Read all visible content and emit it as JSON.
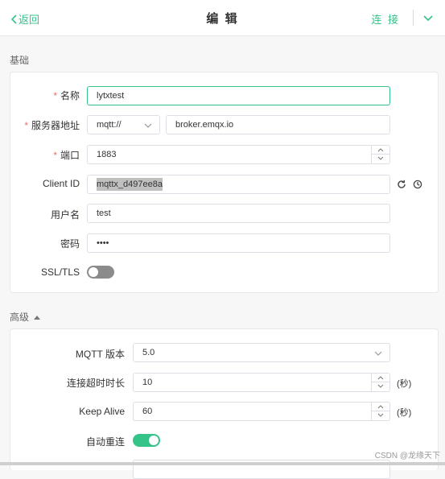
{
  "header": {
    "back_label": "返回",
    "title": "编 辑",
    "connect_label": "连 接"
  },
  "basic": {
    "section_title": "基础",
    "name_label": "名称",
    "name_value": "lytxtest",
    "server_label": "服务器地址",
    "protocol_value": "mqtt://",
    "host_value": "broker.emqx.io",
    "port_label": "端口",
    "port_value": "1883",
    "client_id_label": "Client ID",
    "client_id_value": "mqttx_d497ee8a",
    "username_label": "用户名",
    "username_value": "test",
    "password_label": "密码",
    "password_value": "••••",
    "ssl_label": "SSL/TLS",
    "ssl_enabled": false
  },
  "advanced": {
    "section_title": "高级",
    "mqtt_version_label": "MQTT 版本",
    "mqtt_version_value": "5.0",
    "timeout_label": "连接超时时长",
    "timeout_value": "10",
    "timeout_unit": "(秒)",
    "keepalive_label": "Keep Alive",
    "keepalive_value": "60",
    "keepalive_unit": "(秒)",
    "auto_reconnect_label": "自动重连",
    "auto_reconnect_enabled": true
  },
  "watermark": "CSDN @龙缘天下",
  "colors": {
    "accent": "#34c388",
    "required": "#f56c6c",
    "toggle_off": "#8b8b8b"
  }
}
